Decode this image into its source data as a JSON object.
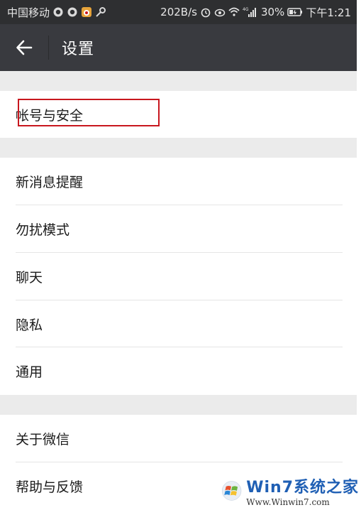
{
  "status_bar": {
    "carrier": "中国移动",
    "network_speed": "202B/s",
    "signal_tag": "4G",
    "battery": "30%",
    "time": "下午1:21",
    "icons_left": [
      "qq-icon",
      "qq-icon",
      "weibo-icon",
      "key-icon"
    ],
    "icons_right": [
      "alarm-icon",
      "eye-icon",
      "wifi-icon",
      "signal-icon",
      "battery-icon"
    ]
  },
  "header": {
    "back_icon": "arrow-left-icon",
    "title": "设置"
  },
  "settings": {
    "group1": [
      {
        "label": "帐号与安全"
      }
    ],
    "group2": [
      {
        "label": "新消息提醒"
      },
      {
        "label": "勿扰模式"
      },
      {
        "label": "聊天"
      },
      {
        "label": "隐私"
      },
      {
        "label": "通用"
      }
    ],
    "group3": [
      {
        "label": "关于微信"
      },
      {
        "label": "帮助与反馈"
      }
    ]
  },
  "annotation": {
    "highlight_color": "#c8171e",
    "highlighted_item": "帐号与安全"
  },
  "watermark": {
    "brand": "Win7系统之家",
    "url": "Www.Winwin7.com"
  },
  "colors": {
    "status_bar_bg": "#2e2f31",
    "nav_bg": "#393a3f",
    "section_gap": "#ebebeb",
    "text": "#1a1a1a"
  }
}
